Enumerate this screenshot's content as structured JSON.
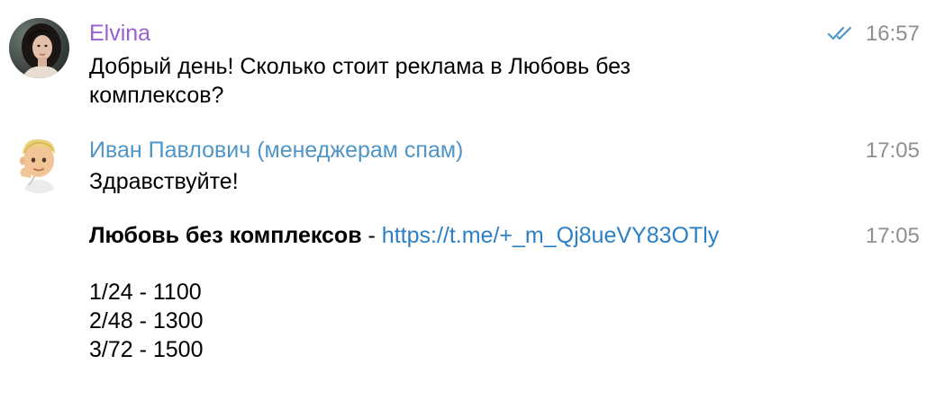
{
  "messages": [
    {
      "sender": "Elvina",
      "sender_color": "#9a5fd0",
      "time": "16:57",
      "status": "read-double-check",
      "text_line1": "Добрый день! Сколько стоит реклама в Любовь без",
      "text_line2": "комплексов?"
    },
    {
      "sender": "Иван Павлович (менеджерам спам)",
      "sender_color": "#4f95c7",
      "time": "17:05",
      "text": "Здравствуйте!"
    },
    {
      "time": "17:05",
      "channel_name": "Любовь без комплексов",
      "separator": " - ",
      "link": "https://t.me/+_m_Qj8ueVY83OTly",
      "link_color": "#2c7fc4",
      "prices": [
        "1/24 - 1100",
        "2/48 - 1300",
        "3/72 - 1500"
      ]
    }
  ],
  "icons": {
    "avatar_1": "avatar-photo-woman",
    "avatar_2": "avatar-memoji-man",
    "status": "double-check-icon"
  }
}
